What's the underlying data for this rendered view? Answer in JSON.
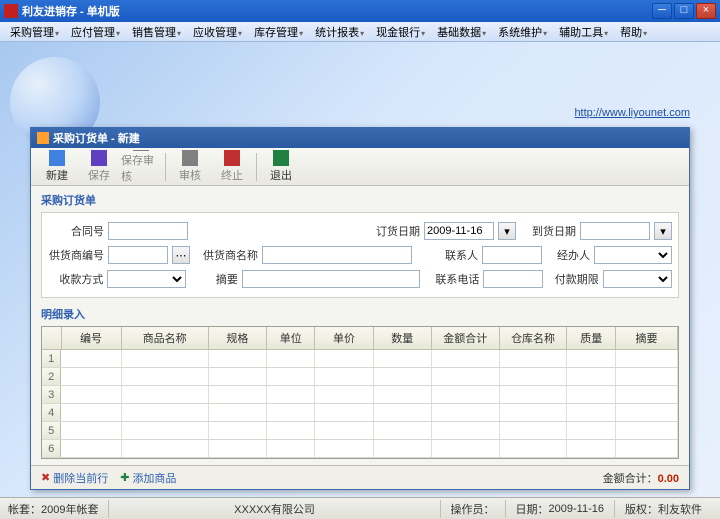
{
  "window": {
    "title": "利友进销存 - 单机版"
  },
  "menu": [
    "采购管理",
    "应付管理",
    "销售管理",
    "应收管理",
    "库存管理",
    "统计报表",
    "现金银行",
    "基础数据",
    "系统维护",
    "辅助工具",
    "帮助"
  ],
  "url": "http://www.liyounet.com",
  "dialog": {
    "title": "采购订货单 - 新建",
    "toolbar": {
      "new": "新建",
      "save": "保存",
      "saveaudit": "保存审核",
      "audit": "审核",
      "stop": "终止",
      "exit": "退出"
    },
    "section1": "采购订货单",
    "form": {
      "contract_no": "合同号",
      "order_date": "订货日期",
      "order_date_val": "2009-11-16",
      "arrive_date": "到货日期",
      "supplier_code": "供货商编号",
      "supplier_name": "供货商名称",
      "contact": "联系人",
      "handler": "经办人",
      "pay_method": "收款方式",
      "summary": "摘要",
      "phone": "联系电话",
      "pay_deadline": "付款期限"
    },
    "section2": "明细录入",
    "cols": [
      "编号",
      "商品名称",
      "规格",
      "单位",
      "单价",
      "数量",
      "金额合计",
      "仓库名称",
      "质量",
      "摘要"
    ],
    "rows": [
      1,
      2,
      3,
      4,
      5,
      6
    ],
    "footer": {
      "delrow": "删除当前行",
      "addprod": "添加商品",
      "total_label": "金额合计：",
      "total": "0.00"
    }
  },
  "status": {
    "book": "帐套：2009年帐套",
    "company": "XXXXX有限公司",
    "operator_label": "操作员：",
    "date_label": "日期：",
    "date": "2009-11-16",
    "copyright": "版权：利友软件"
  },
  "colw": {
    "rn": 20,
    "c0": 62,
    "c1": 90,
    "c2": 60,
    "c3": 50,
    "c4": 60,
    "c5": 60,
    "c6": 70,
    "c7": 70,
    "c8": 50,
    "c9": 64
  }
}
